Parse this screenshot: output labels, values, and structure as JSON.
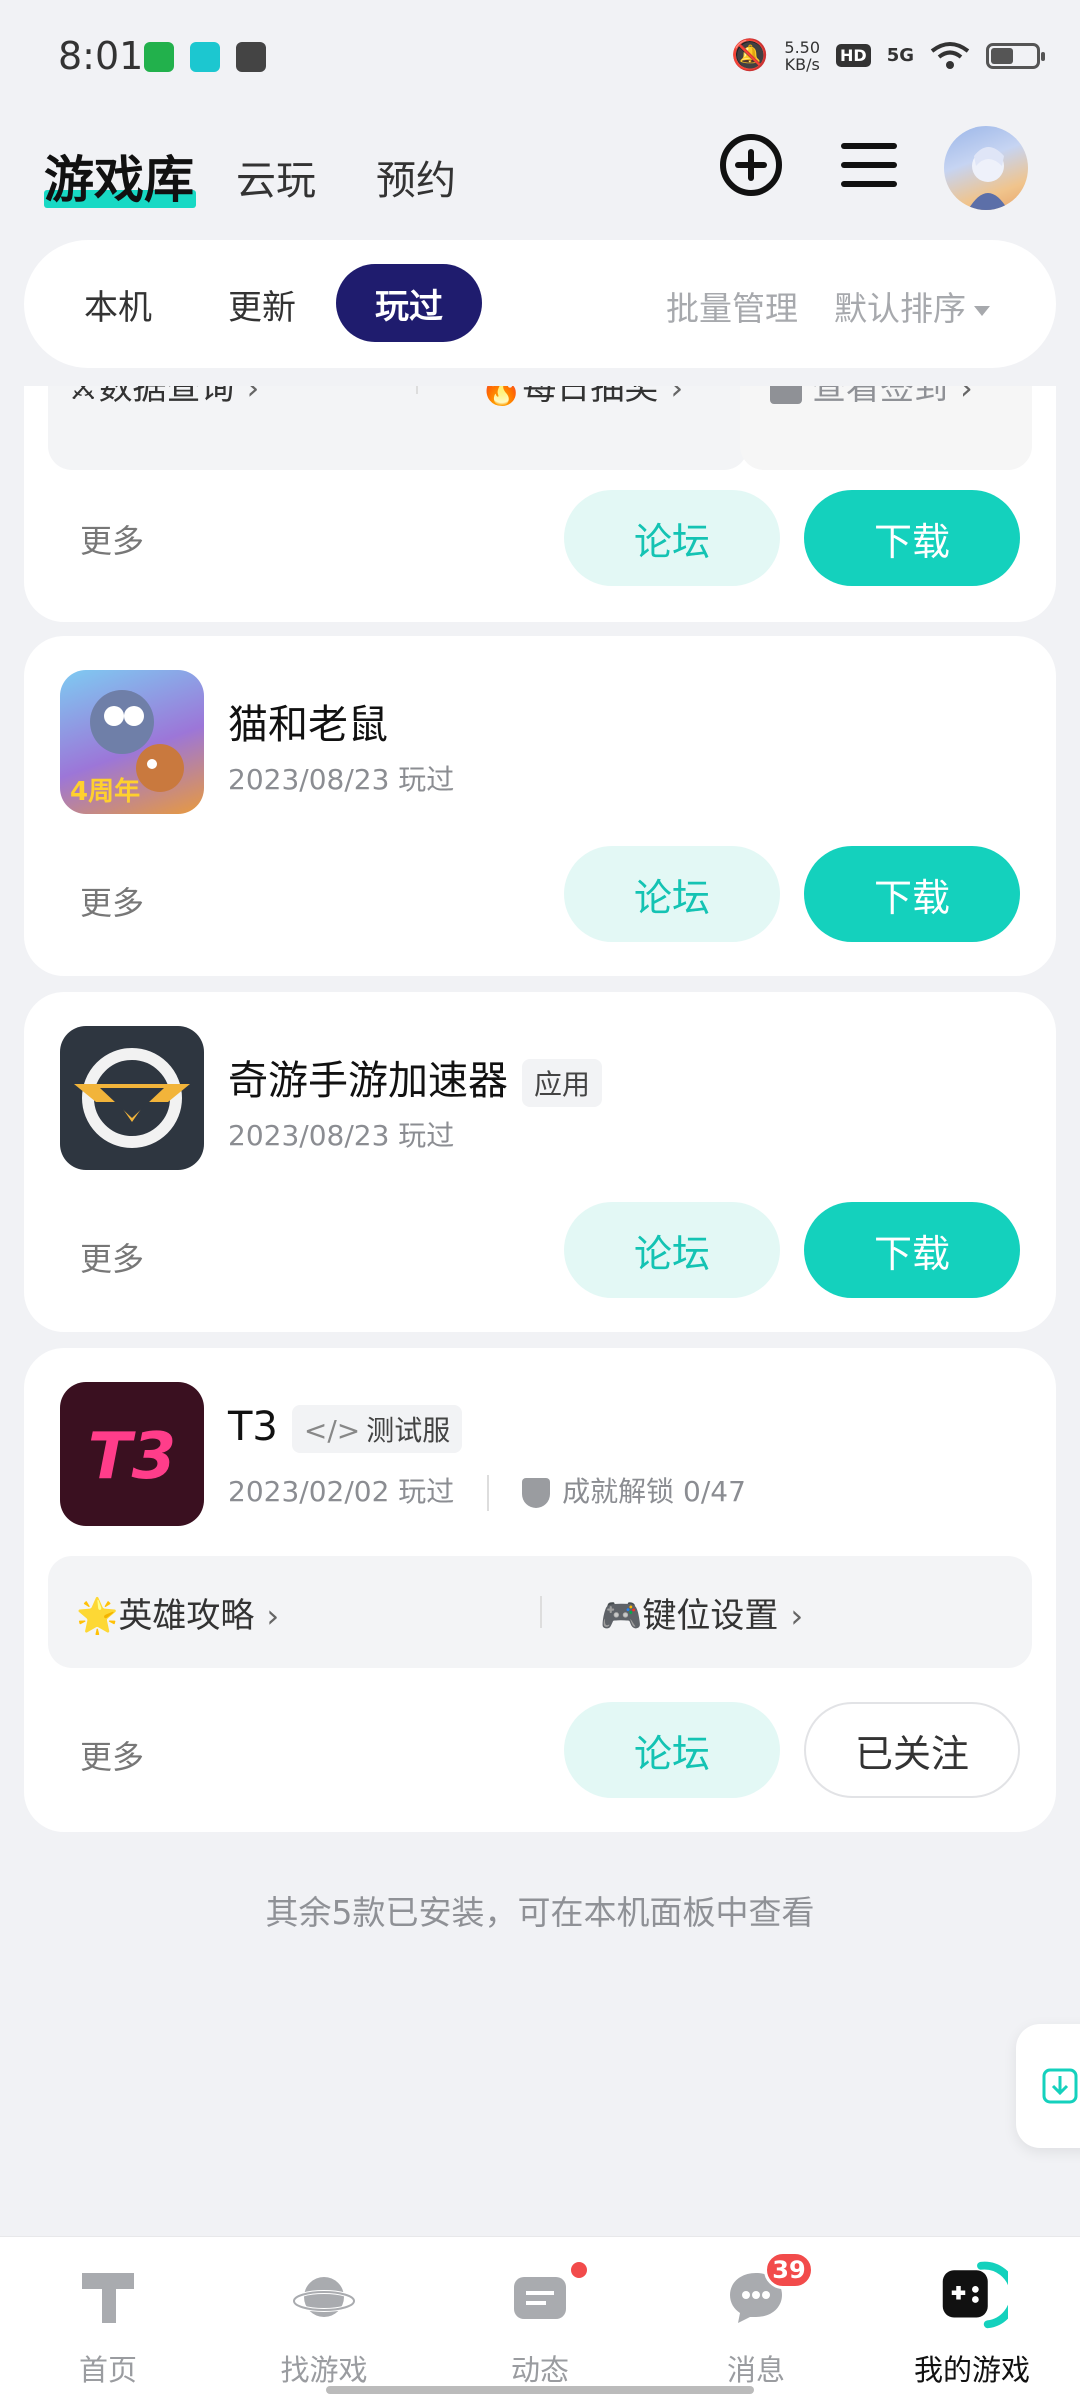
{
  "status_bar": {
    "time": "8:01",
    "speed_value": "5.50",
    "speed_unit": "KB/s",
    "hd_label": "HD",
    "network_label": "5G",
    "battery_level": 0.45,
    "app_icons": [
      "seven-app-icon",
      "tap-app-icon",
      "chat-app-icon"
    ]
  },
  "header": {
    "title": "游戏库",
    "tabs": [
      "云玩",
      "预约"
    ],
    "icons": [
      "add-circle-icon",
      "menu-icon",
      "avatar"
    ]
  },
  "subtabs": {
    "items": [
      "本机",
      "更新"
    ],
    "active": "玩过",
    "batch_manage": "批量管理",
    "sort_label": "默认排序"
  },
  "cards": [
    {
      "quick_actions": [
        "数据查询",
        "每日抽奖"
      ],
      "quick_action_right": "查看签到",
      "more": "更多",
      "forum": "论坛",
      "download": "下载"
    },
    {
      "name": "猫和老鼠",
      "date": "2023/08/23 玩过",
      "icon_badge": "4周年",
      "more": "更多",
      "forum": "论坛",
      "download": "下载"
    },
    {
      "name": "奇游手游加速器",
      "tag": "应用",
      "date": "2023/08/23 玩过",
      "more": "更多",
      "forum": "论坛",
      "download": "下载"
    },
    {
      "name": "T3",
      "icon_text": "T3",
      "tag": "测试服",
      "date": "2023/02/02 玩过",
      "achievement": "成就解锁 0/47",
      "quick_actions": [
        "英雄攻略",
        "键位设置"
      ],
      "more": "更多",
      "forum": "论坛",
      "follow": "已关注"
    }
  ],
  "footer_note": "其余5款已安装，可在本机面板中查看",
  "bottom_nav": [
    {
      "label": "首页",
      "icon": "home-tap-icon"
    },
    {
      "label": "找游戏",
      "icon": "planet-icon"
    },
    {
      "label": "动态",
      "icon": "feed-icon",
      "dot": true
    },
    {
      "label": "消息",
      "icon": "message-icon",
      "badge": "39"
    },
    {
      "label": "我的游戏",
      "icon": "gamepad-icon",
      "active": true
    }
  ],
  "colors": {
    "accent": "#14d1bd",
    "accent_light": "#e3f8f5",
    "active_tab": "#1f1c6e",
    "badge_red": "#f24b4b"
  }
}
